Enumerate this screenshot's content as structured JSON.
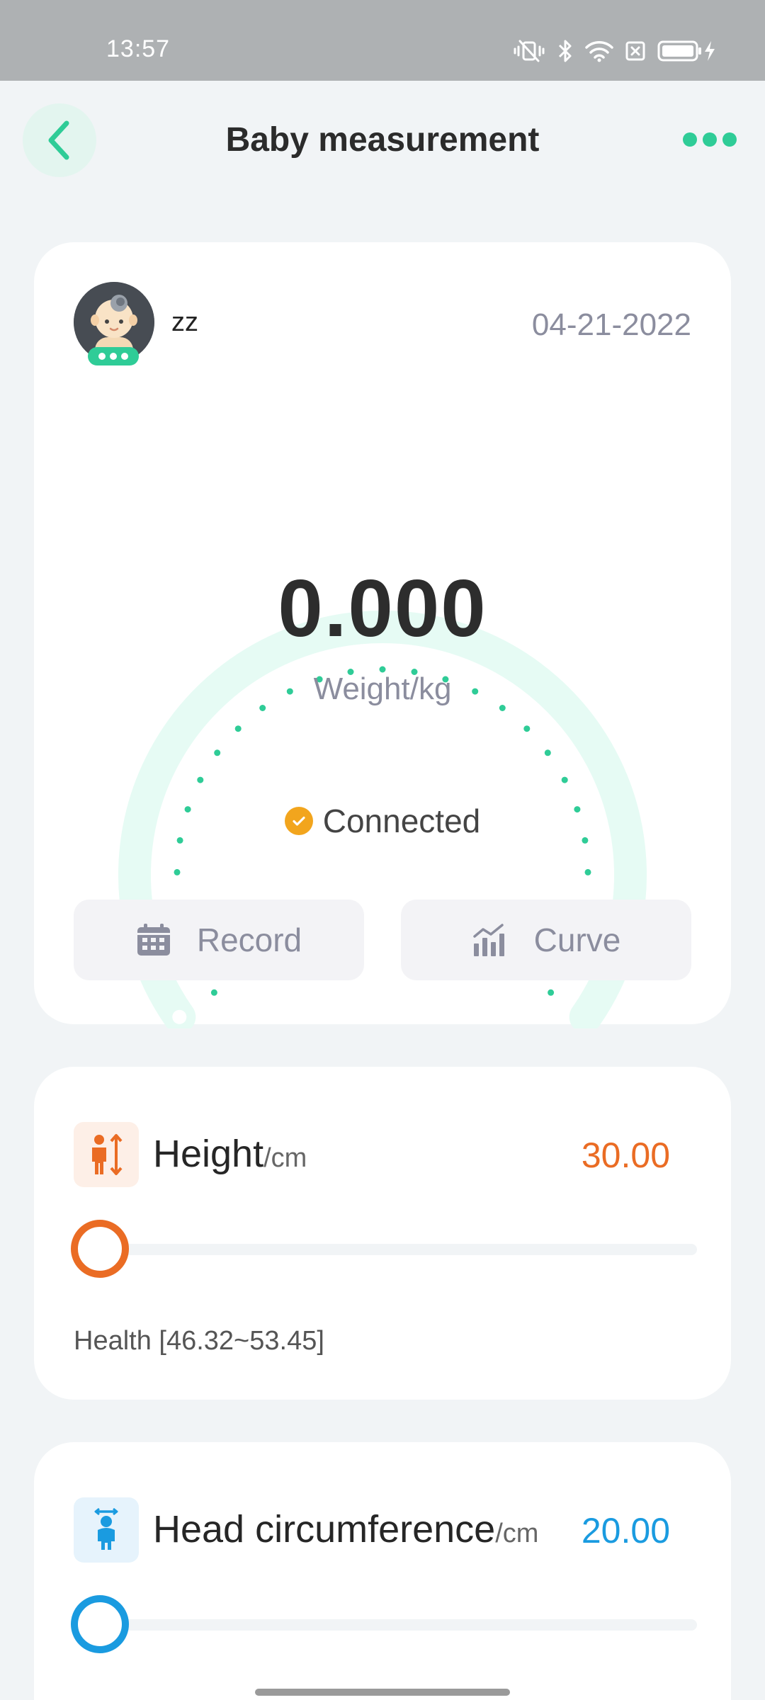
{
  "status_bar": {
    "time": "13:57",
    "icons": [
      "vibrate-mute-icon",
      "bluetooth-icon",
      "wifi-icon",
      "sim-none-icon",
      "battery-charging-icon"
    ]
  },
  "header": {
    "title": "Baby measurement",
    "back_icon": "chevron-left-icon",
    "more_icon": "more-dots-icon"
  },
  "profile": {
    "name": "zz",
    "date": "04-21-2022"
  },
  "scale": {
    "weight": "0.000",
    "unit_label": "Weight/kg",
    "status": "Connected"
  },
  "actions": {
    "record_label": "Record",
    "curve_label": "Curve"
  },
  "metrics": {
    "height": {
      "title": "Height",
      "unit": "/cm",
      "value": "30.00",
      "health": "Health  [46.32~53.45]",
      "color": "#ea6c24",
      "slider_fraction": 0
    },
    "head": {
      "title": "Head circumference",
      "unit": "/cm",
      "value": "20.00",
      "color": "#1a9be0",
      "slider_fraction": 0
    }
  },
  "colors": {
    "accent": "#2fcc97",
    "gauge_track": "#e6fbf4",
    "connected_badge": "#f2a51d",
    "muted_text": "#8b8d9e"
  }
}
